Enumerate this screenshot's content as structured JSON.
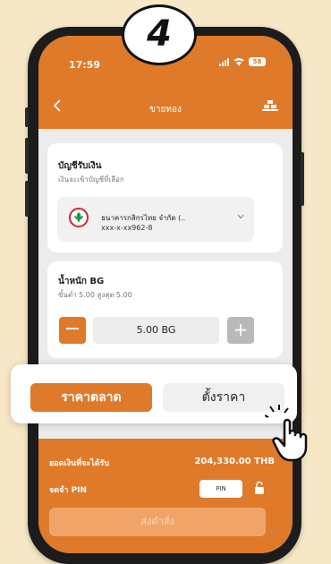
{
  "step_number": "4",
  "status_bar": {
    "time": "17:59",
    "battery": "58"
  },
  "header": {
    "title": "ขายทอง"
  },
  "account_section": {
    "title": "บัญชีรับเงิน",
    "subtitle": "เงินจะเข้าบัญชีที่เลือก",
    "bank_name": "ธนาคารกสิกรไทย จำกัด (..",
    "account_number": "xxx-x-xx962-8"
  },
  "weight_section": {
    "title": "น้ำหนัก BG",
    "limits": "ขั้นต่ำ 5.00  สูงสุด 5.00",
    "amount": "5.00 BG",
    "minus_label": "−",
    "plus_label": "+"
  },
  "order_type": {
    "market_label": "ราคาตลาด",
    "set_price_label": "ตั้งราคา",
    "selected": "market"
  },
  "summary": {
    "receive_label": "ยอดเงินที่จะได้รับ",
    "receive_value": "204,330.00 THB",
    "pin_label": "จดจำ PIN",
    "pin_button": "PIN",
    "submit_label": "ส่งคำสั่ง"
  },
  "colors": {
    "accent": "#df7a2a",
    "background": "#f6e8c6",
    "bank_brand": "#1b9a49"
  },
  "icons": [
    "back-arrow-icon",
    "gold-bars-icon",
    "kbank-logo-icon",
    "chevron-down-icon",
    "lock-icon",
    "pointer-hand-icon"
  ]
}
